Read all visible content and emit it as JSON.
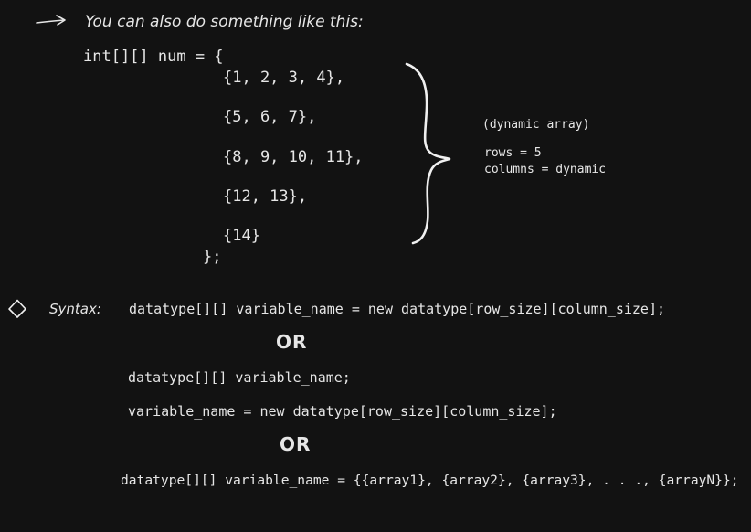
{
  "intro": {
    "arrow_icon": "right-arrow-icon",
    "text": "You can also do something like this:"
  },
  "code_block": {
    "declaration": "int[][] num = {",
    "rows": [
      "{1, 2, 3, 4},",
      "{5, 6, 7},",
      "{8, 9, 10, 11},",
      "{12, 13},",
      "{14}"
    ],
    "closing": "};"
  },
  "annotation": {
    "brace_icon": "curly-brace-icon",
    "title": "(dynamic array)",
    "rows_line": "rows = 5",
    "columns_line": "columns = dynamic"
  },
  "syntax": {
    "bullet_icon": "diamond-icon",
    "label": "Syntax:",
    "line1": "datatype[][] variable_name = new datatype[row_size][column_size];",
    "or1": "OR",
    "line2": "datatype[][] variable_name;",
    "line3": "variable_name = new datatype[row_size][column_size];",
    "or2": "OR",
    "line4": "datatype[][] variable_name = {{array1}, {array2}, {array3}, . . ., {arrayN}};"
  }
}
